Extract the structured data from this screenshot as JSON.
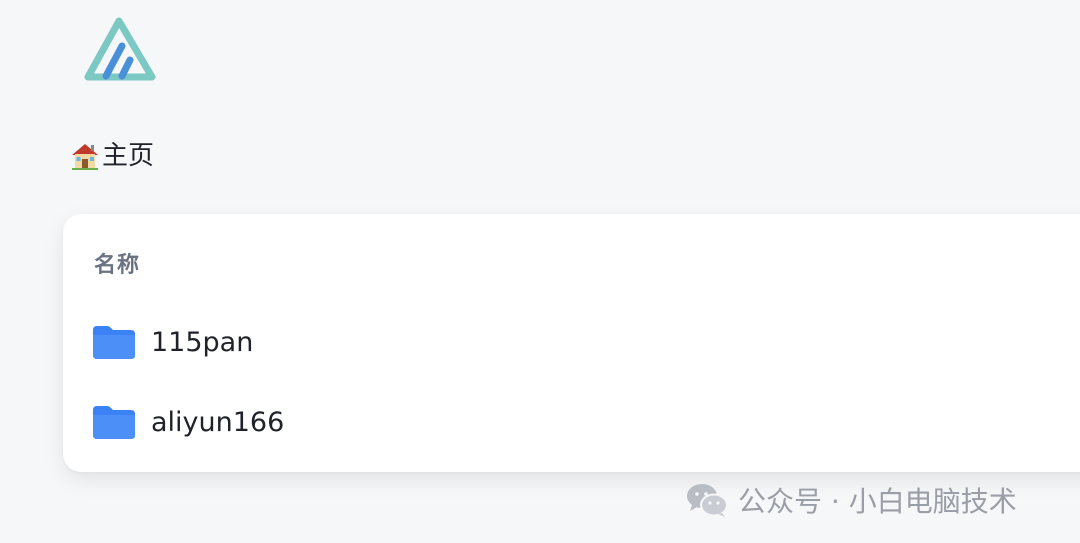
{
  "breadcrumb": {
    "home_label": "主页"
  },
  "table": {
    "column_name": "名称"
  },
  "files": [
    {
      "name": "115pan",
      "icon": "folder-icon"
    },
    {
      "name": "aliyun166",
      "icon": "folder-icon"
    }
  ],
  "watermark": {
    "text": "公众号 · 小白电脑技术"
  },
  "colors": {
    "background": "#f6f7f9",
    "card": "#ffffff",
    "folder": "#3b82f6",
    "logo_outer": "#7cc9c3",
    "logo_inner": "#4a90d9"
  }
}
